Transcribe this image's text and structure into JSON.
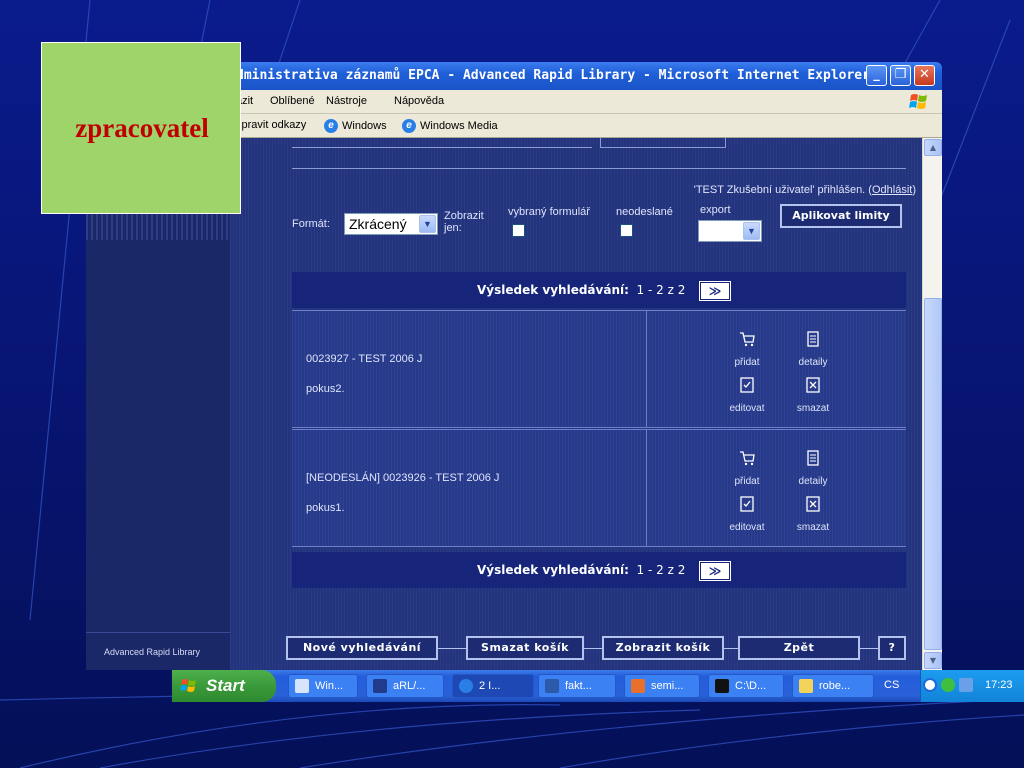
{
  "window": {
    "title": "Administrativa záznamů EPCA - Advanced Rapid Library - Microsoft Internet Explorer",
    "title_visible": "dministrativa záznamů EPCA - Advanced Rapid Library - Microsoft Internet Explorer"
  },
  "menubar": {
    "items": [
      "azit",
      "Oblíbené",
      "Nástroje",
      "Nápověda"
    ]
  },
  "linksbar": {
    "items": [
      "Jpravit odkazy",
      "Windows",
      "Windows Media"
    ]
  },
  "sidebar": {
    "footer": "Advanced Rapid Library"
  },
  "session": {
    "logged_prefix": "'TEST Zkušební uživatel' přihlášen. (",
    "logout_label": "Odhlásit",
    "logged_suffix": ")"
  },
  "filters": {
    "format_label": "Formát:",
    "format_value": "Zkrácený",
    "show_only_label_1": "Zobrazit",
    "show_only_label_2": "jen:",
    "selected_form_label": "vybraný formulář",
    "unsent_label": "neodeslané",
    "export_label": "export",
    "apply_button": "Aplikovat limity"
  },
  "results": {
    "label": "Výsledek vyhledávání:",
    "range": "1 - 2  z 2",
    "next_symbol": "≫"
  },
  "records": [
    {
      "title": "0023927 - TEST 2006 J",
      "subtitle": "pokus2.",
      "actions": {
        "add": "přidat",
        "details": "detaily",
        "edit": "editovat",
        "delete": "smazat"
      }
    },
    {
      "title": "[NEODESLÁN] 0023926 - TEST 2006 J",
      "subtitle": "pokus1.",
      "actions": {
        "add": "přidat",
        "details": "detaily",
        "edit": "editovat",
        "delete": "smazat"
      }
    }
  ],
  "bottom_nav": {
    "new_search": "Nové vyhledávání",
    "clear_cart": "Smazat košík",
    "show_cart": "Zobrazit košík",
    "back": "Zpět",
    "help": "?"
  },
  "taskbar": {
    "start": "Start",
    "tasks": [
      "Win...",
      "aRL/...",
      "2 I...",
      "fakt...",
      "semi...",
      "C:\\D...",
      "robe..."
    ],
    "language": "CS",
    "clock": "17:23"
  },
  "overlay": {
    "label": "zpracovatel"
  },
  "colors": {
    "accent_green": "#9fd46a",
    "label_red": "#c00000",
    "page_blue": "#22347f",
    "bar_navy": "#16257a"
  }
}
